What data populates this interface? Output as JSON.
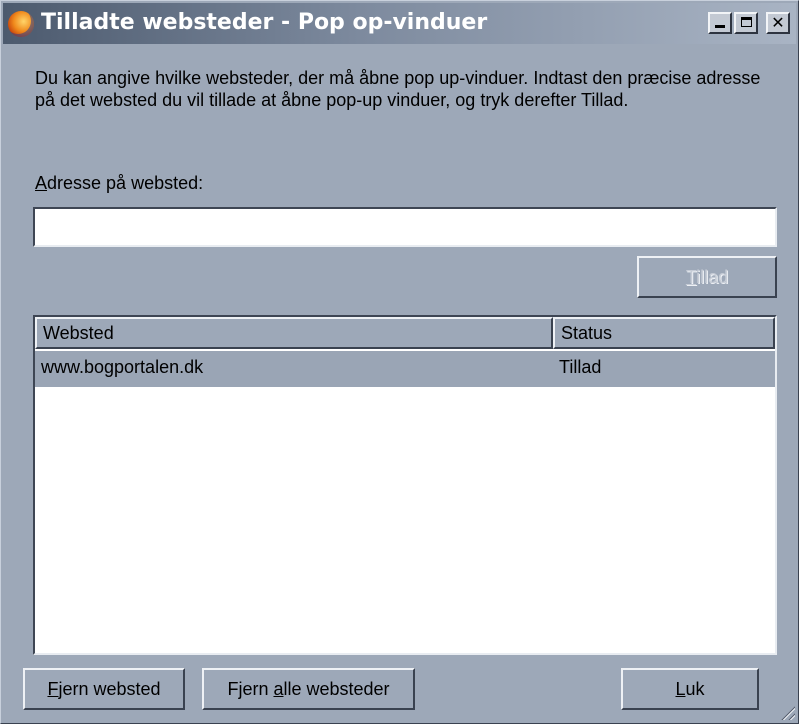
{
  "window": {
    "title": "Tilladte websteder - Pop op-vinduer",
    "icon": "firefox-icon"
  },
  "description": "Du kan angive hvilke websteder, der må åbne pop up-vinduer. Indtast den præcise adresse på det websted du vil tillade at åbne pop-up vinduer, og tryk derefter Tillad.",
  "address": {
    "label_prefix": "A",
    "label_rest": "dresse på websted:",
    "value": ""
  },
  "allow_button": {
    "accel": "T",
    "rest": "illad",
    "enabled": false
  },
  "list": {
    "columns": [
      "Websted",
      "Status"
    ],
    "rows": [
      {
        "site": "www.bogportalen.dk",
        "status": "Tillad"
      }
    ]
  },
  "footer": {
    "remove": {
      "accel": "F",
      "rest": "jern websted"
    },
    "remove_all": {
      "pre": "Fjern ",
      "accel": "a",
      "rest": "lle websteder"
    },
    "close": {
      "accel": "L",
      "rest": "uk"
    }
  }
}
